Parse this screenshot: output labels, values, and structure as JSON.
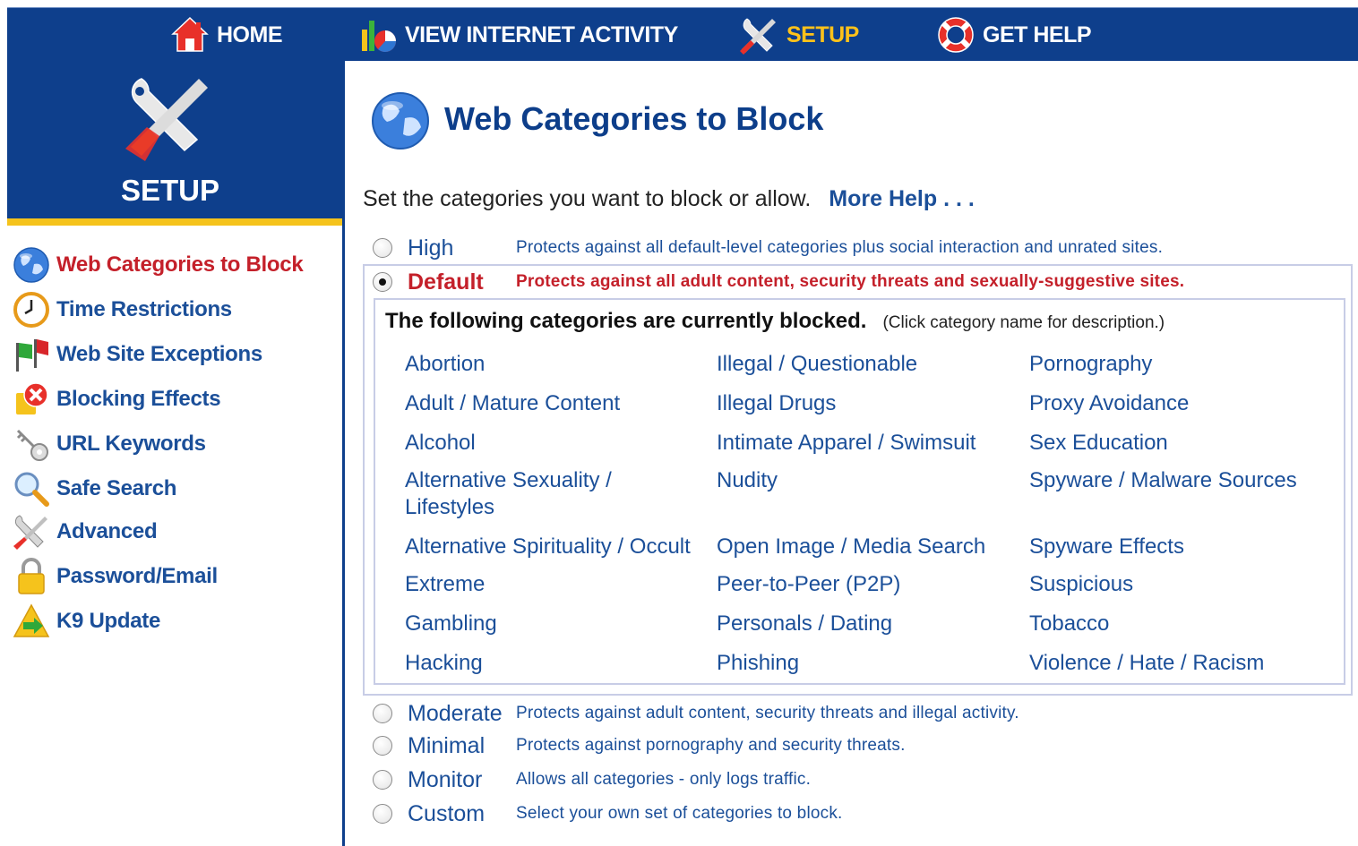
{
  "nav": {
    "items": [
      {
        "label": "HOME",
        "icon": "home-icon"
      },
      {
        "label": "VIEW INTERNET ACTIVITY",
        "icon": "activity-chart-icon"
      },
      {
        "label": "SETUP",
        "icon": "tools-icon",
        "active": true
      },
      {
        "label": "GET HELP",
        "icon": "lifebuoy-icon"
      }
    ]
  },
  "sidebar": {
    "header_title": "SETUP",
    "items": [
      {
        "label": "Web Categories to Block",
        "icon": "globe-icon",
        "active": true
      },
      {
        "label": "Time Restrictions",
        "icon": "clock-icon"
      },
      {
        "label": "Web Site Exceptions",
        "icon": "flags-icon"
      },
      {
        "label": "Blocking Effects",
        "icon": "block-effect-icon"
      },
      {
        "label": "URL Keywords",
        "icon": "key-icon"
      },
      {
        "label": "Safe Search",
        "icon": "magnifier-icon"
      },
      {
        "label": "Advanced",
        "icon": "tools-icon"
      },
      {
        "label": "Password/Email",
        "icon": "padlock-icon"
      },
      {
        "label": "K9 Update",
        "icon": "update-arrow-icon"
      }
    ]
  },
  "main": {
    "title": "Web Categories to Block",
    "intro": "Set the categories you want to block or allow.",
    "more_help": "More Help . . .",
    "levels": [
      {
        "name": "High",
        "desc": "Protects against all default-level categories plus social interaction and unrated sites.",
        "checked": false
      },
      {
        "name": "Default",
        "desc": "Protects against all adult content, security threats and sexually-suggestive sites.",
        "checked": true
      },
      {
        "name": "Moderate",
        "desc": "Protects against adult content, security threats and illegal activity.",
        "checked": false
      },
      {
        "name": "Minimal",
        "desc": "Protects against pornography and security threats.",
        "checked": false
      },
      {
        "name": "Monitor",
        "desc": "Allows all categories - only logs traffic.",
        "checked": false
      },
      {
        "name": "Custom",
        "desc": "Select your own set of categories to block.",
        "checked": false
      }
    ],
    "blocked_heading": "The following categories are currently blocked.",
    "blocked_note": "(Click category name for description.)",
    "categories": {
      "col1": [
        "Abortion",
        "Adult / Mature Content",
        "Alcohol",
        "Alternative Sexuality / Lifestyles",
        "Alternative Spirituality / Occult",
        "Extreme",
        "Gambling",
        "Hacking"
      ],
      "col2": [
        "Illegal / Questionable",
        "Illegal Drugs",
        "Intimate Apparel / Swimsuit",
        "Nudity",
        "Open Image / Media Search",
        "Peer-to-Peer (P2P)",
        "Personals / Dating",
        "Phishing"
      ],
      "col3": [
        "Pornography",
        "Proxy Avoidance",
        "Sex Education",
        "Spyware / Malware Sources",
        "Spyware Effects",
        "Suspicious",
        "Tobacco",
        "Violence / Hate / Racism"
      ]
    }
  },
  "colors": {
    "nav_bg": "#0e3f8c",
    "accent_yellow": "#f5c31c",
    "link_blue": "#1b4f99",
    "active_red": "#c4202a"
  }
}
